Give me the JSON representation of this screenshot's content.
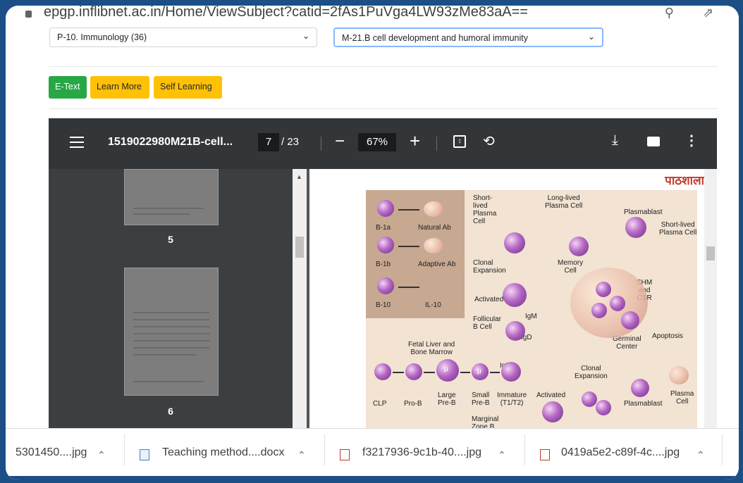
{
  "browser": {
    "url": "epgp.inflibnet.ac.in/Home/ViewSubject?catid=2fAs1PuVga4LW93zMe83aA=="
  },
  "filters": {
    "paper_select": "P-10. Immunology (36)",
    "module_select": "M-21.B cell development and humoral immunity"
  },
  "tabs": {
    "etext": "E-Text",
    "learn_more": "Learn More",
    "self_learning": "Self Learning"
  },
  "pdf": {
    "title": "1519022980M21B-cell...",
    "current_page": "7",
    "total_pages": "/ 23",
    "zoom": "67%",
    "thumb_labels": [
      "5",
      "6"
    ],
    "logo": "पाठशाला"
  },
  "figure_labels": {
    "b1a": "B-1a",
    "b1b": "B-1b",
    "b10": "B-10",
    "natural_ab": "Natural Ab",
    "adaptive_ab": "Adaptive Ab",
    "il10": "IL-10",
    "short_lived_plasma": "Short-\nlived\nPlasma\nCell",
    "long_lived_plasma": "Long-lived\nPlasma Cell",
    "plasmablast_top": "Plasmablast",
    "short_lived_plasma_right": "Short-lived\nPlasma Cell",
    "clonal_expansion_top": "Clonal\nExpansion",
    "memory_cell": "Memory\nCell",
    "activated_top": "Activated",
    "shm_csr": "SHM\nand\nCSR",
    "follicular_b": "Follicular\nB Cell",
    "igm_1": "IgM",
    "igd": "IgD",
    "germinal_center": "Germinal\nCenter",
    "apoptosis": "Apoptosis",
    "fetal_liver": "Fetal Liver and\nBone Marrow",
    "igm_2": "IgM",
    "clonal_expansion_bottom": "Clonal\nExpansion",
    "clp": "CLP",
    "pro_b": "Pro-B",
    "large_pre_b": "Large\nPre-B",
    "small_pre_b": "Small\nPre-B",
    "immature": "Immature\n(T1/T2)",
    "activated_bottom": "Activated",
    "plasmablast_bottom": "Plasmablast",
    "plasma_cell": "Plasma\nCell",
    "marginal_zone": "Marginal\nZone B",
    "mu_1": "μ",
    "mu_2": "μ"
  },
  "downloads": [
    {
      "name": "5301450....jpg"
    },
    {
      "name": "Teaching method....docx"
    },
    {
      "name": "f3217936-9c1b-40....jpg"
    },
    {
      "name": "0419a5e2-c89f-4c....jpg"
    }
  ]
}
